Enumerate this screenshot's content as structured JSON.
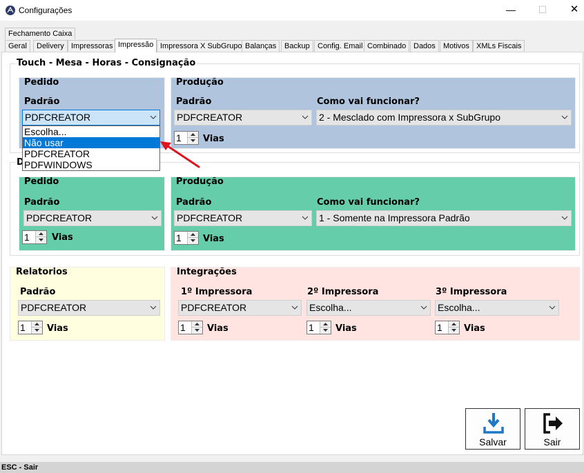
{
  "window": {
    "title": "Configurações",
    "minimize": "—",
    "maximize": "☐",
    "close": "✕"
  },
  "tabs_row1": [
    {
      "label": "Fechamento Caixa"
    }
  ],
  "tabs_row2": [
    {
      "label": "Geral"
    },
    {
      "label": "Delivery"
    },
    {
      "label": "Impressoras"
    },
    {
      "label": "Impressão"
    },
    {
      "label": "Impressora X SubGrupo"
    },
    {
      "label": "Balanças"
    },
    {
      "label": "Backup"
    },
    {
      "label": "Config. Email"
    },
    {
      "label": "Combinado"
    },
    {
      "label": "Dados"
    },
    {
      "label": "Motivos"
    },
    {
      "label": "XMLs Fiscais"
    }
  ],
  "active_tab": "Impressão",
  "touch_group": {
    "title": "Touch - Mesa - Horas - Consignação",
    "pedido": {
      "title": "Pedido",
      "padrao_label": "Padrão",
      "padrao_value": "PDFCREATOR"
    },
    "producao": {
      "title": "Produção",
      "padrao_label": "Padrão",
      "padrao_value": "PDFCREATOR",
      "como_label": "Como vai funcionar?",
      "como_value": "2 - Mesclado com Impressora x SubGrupo",
      "vias_value": "1",
      "vias_label": "Vias"
    },
    "colors": {
      "panel_bg": "#b0c4de"
    }
  },
  "dropdown_open": {
    "options": [
      "Escolha...",
      "Não usar",
      "PDFCREATOR",
      "PDFWINDOWS"
    ],
    "selected": "Não usar"
  },
  "delivery_group": {
    "title": "D",
    "pedido": {
      "title": "Pedido",
      "padrao_label": "Padrão",
      "padrao_value": "PDFCREATOR",
      "vias_value": "1",
      "vias_label": "Vias"
    },
    "producao": {
      "title": "Produção",
      "padrao_label": "Padrão",
      "padrao_value": "PDFCREATOR",
      "como_label": "Como vai funcionar?",
      "como_value": "1 - Somente na Impressora Padrão",
      "vias_value": "1",
      "vias_label": "Vias"
    },
    "colors": {
      "panel_bg": "#66cdaa"
    }
  },
  "relatorios": {
    "title": "Relatorios",
    "padrao_label": "Padrão",
    "padrao_value": "PDFCREATOR",
    "vias_value": "1",
    "vias_label": "Vias",
    "color": "#ffffe0"
  },
  "integracoes": {
    "title": "Integrações",
    "color": "#ffe4e1",
    "impressoras": [
      {
        "label": "1º Impressora",
        "value": "PDFCREATOR",
        "vias_value": "1",
        "vias_label": "Vias"
      },
      {
        "label": "2º Impressora",
        "value": "Escolha...",
        "vias_value": "1",
        "vias_label": "Vias"
      },
      {
        "label": "3º Impressora",
        "value": "Escolha...",
        "vias_value": "1",
        "vias_label": "Vias"
      }
    ]
  },
  "buttons": {
    "salvar": "Salvar",
    "sair": "Sair"
  },
  "statusbar": {
    "text": "ESC - Sair"
  },
  "icons": {
    "app": "feather-logo-icon",
    "chevron": "chevron-down-icon",
    "spin_up": "spin-up-icon",
    "spin_down": "spin-down-icon",
    "save": "download-tray-icon",
    "exit": "exit-door-icon",
    "pointer": "red-arrow-annotation"
  }
}
